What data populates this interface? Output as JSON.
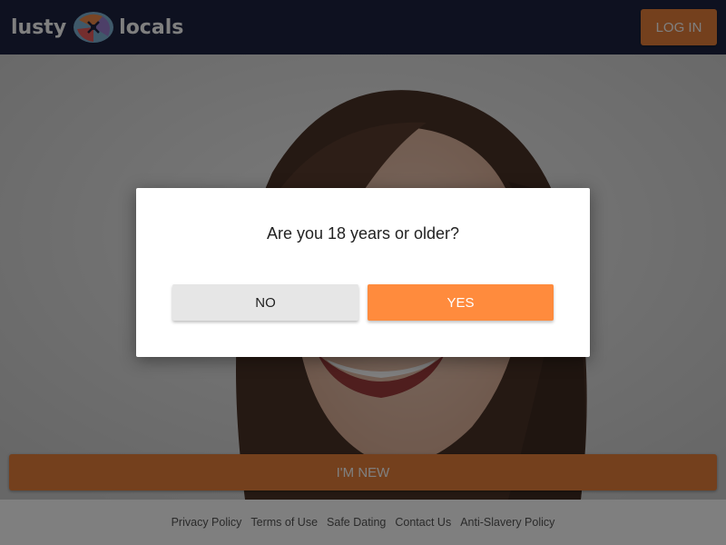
{
  "header": {
    "logo_left": "lusty",
    "logo_right": "locals",
    "login_label": "LOG IN"
  },
  "hero": {
    "new_label": "I'M NEW"
  },
  "dialog": {
    "question": "Are you 18 years or older?",
    "no_label": "NO",
    "yes_label": "YES"
  },
  "footer": {
    "links": [
      "Privacy Policy",
      "Terms of Use",
      "Safe Dating",
      "Contact Us",
      "Anti-Slavery Policy"
    ]
  },
  "colors": {
    "header_bg": "#1c2340",
    "accent": "#e8813a",
    "yes_button": "#ff8b3d",
    "no_button": "#e6e6e6"
  }
}
